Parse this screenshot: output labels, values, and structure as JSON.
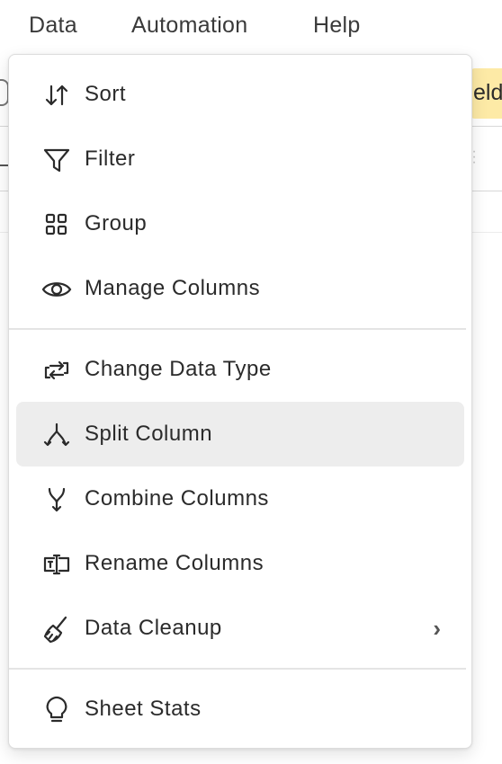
{
  "menubar": {
    "items": [
      "Data",
      "Automation",
      "Help"
    ]
  },
  "background": {
    "chip_text": "eld"
  },
  "data_menu": {
    "items": [
      {
        "label": "Sort",
        "icon": "sort-arrows-icon"
      },
      {
        "label": "Filter",
        "icon": "filter-funnel-icon"
      },
      {
        "label": "Group",
        "icon": "group-grid-icon"
      },
      {
        "label": "Manage Columns",
        "icon": "eye-icon"
      },
      {
        "label": "Change Data Type",
        "icon": "change-type-icon"
      },
      {
        "label": "Split Column",
        "icon": "split-icon",
        "highlighted": true
      },
      {
        "label": "Combine Columns",
        "icon": "combine-icon"
      },
      {
        "label": "Rename Columns",
        "icon": "rename-icon"
      },
      {
        "label": "Data Cleanup",
        "icon": "broom-icon",
        "submenu_indicator": "›"
      },
      {
        "label": "Sheet Stats",
        "icon": "lightbulb-icon"
      }
    ]
  },
  "colors": {
    "highlight": "#ededed",
    "divider": "#e4e4e4",
    "chip": "#fdeaa6",
    "text": "#2b2b2b"
  }
}
